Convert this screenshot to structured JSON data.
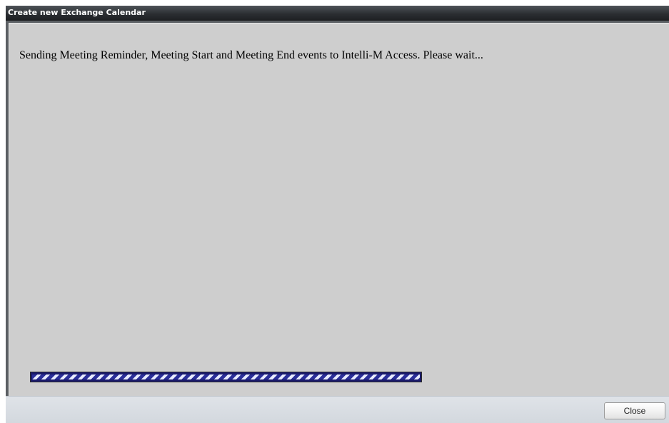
{
  "dialog": {
    "title": "Create new Exchange Calendar",
    "message": "Sending Meeting Reminder, Meeting Start and Meeting End events to Intelli-M Access. Please wait...",
    "progress": {
      "fraction": 1.0
    },
    "close_label": "Close"
  },
  "colors": {
    "title_bar": "#2b2e32",
    "content_background": "#cecece",
    "progress_stripe_dark": "#2b2f9a",
    "progress_stripe_light": "#e8ecff"
  }
}
